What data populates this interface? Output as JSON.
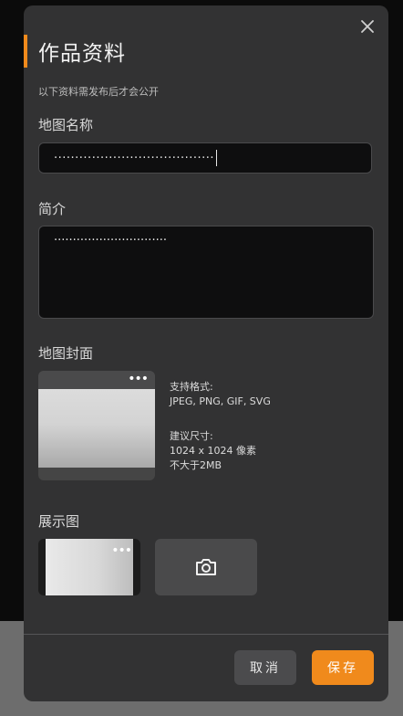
{
  "dialog": {
    "title": "作品资料",
    "subtitle": "以下资料需发布后才会公开",
    "accent_color": "#f08a1c"
  },
  "map_name": {
    "label": "地图名称",
    "value": "······································"
  },
  "intro": {
    "label": "简介",
    "value": "······························"
  },
  "cover": {
    "label": "地图封面",
    "more_icon": "more-horizontal-icon",
    "formats_label": "支持格式:",
    "formats": "JPEG, PNG, GIF, SVG",
    "size_label": "建议尺寸:",
    "size": "1024 x 1024 像素",
    "max_size": "不大于2MB"
  },
  "showcase": {
    "label": "展示图",
    "more_icon": "more-horizontal-icon",
    "add_icon": "camera-icon"
  },
  "footer": {
    "cancel_label": "取消",
    "save_label": "保存"
  },
  "icons": {
    "close": "close-icon"
  }
}
